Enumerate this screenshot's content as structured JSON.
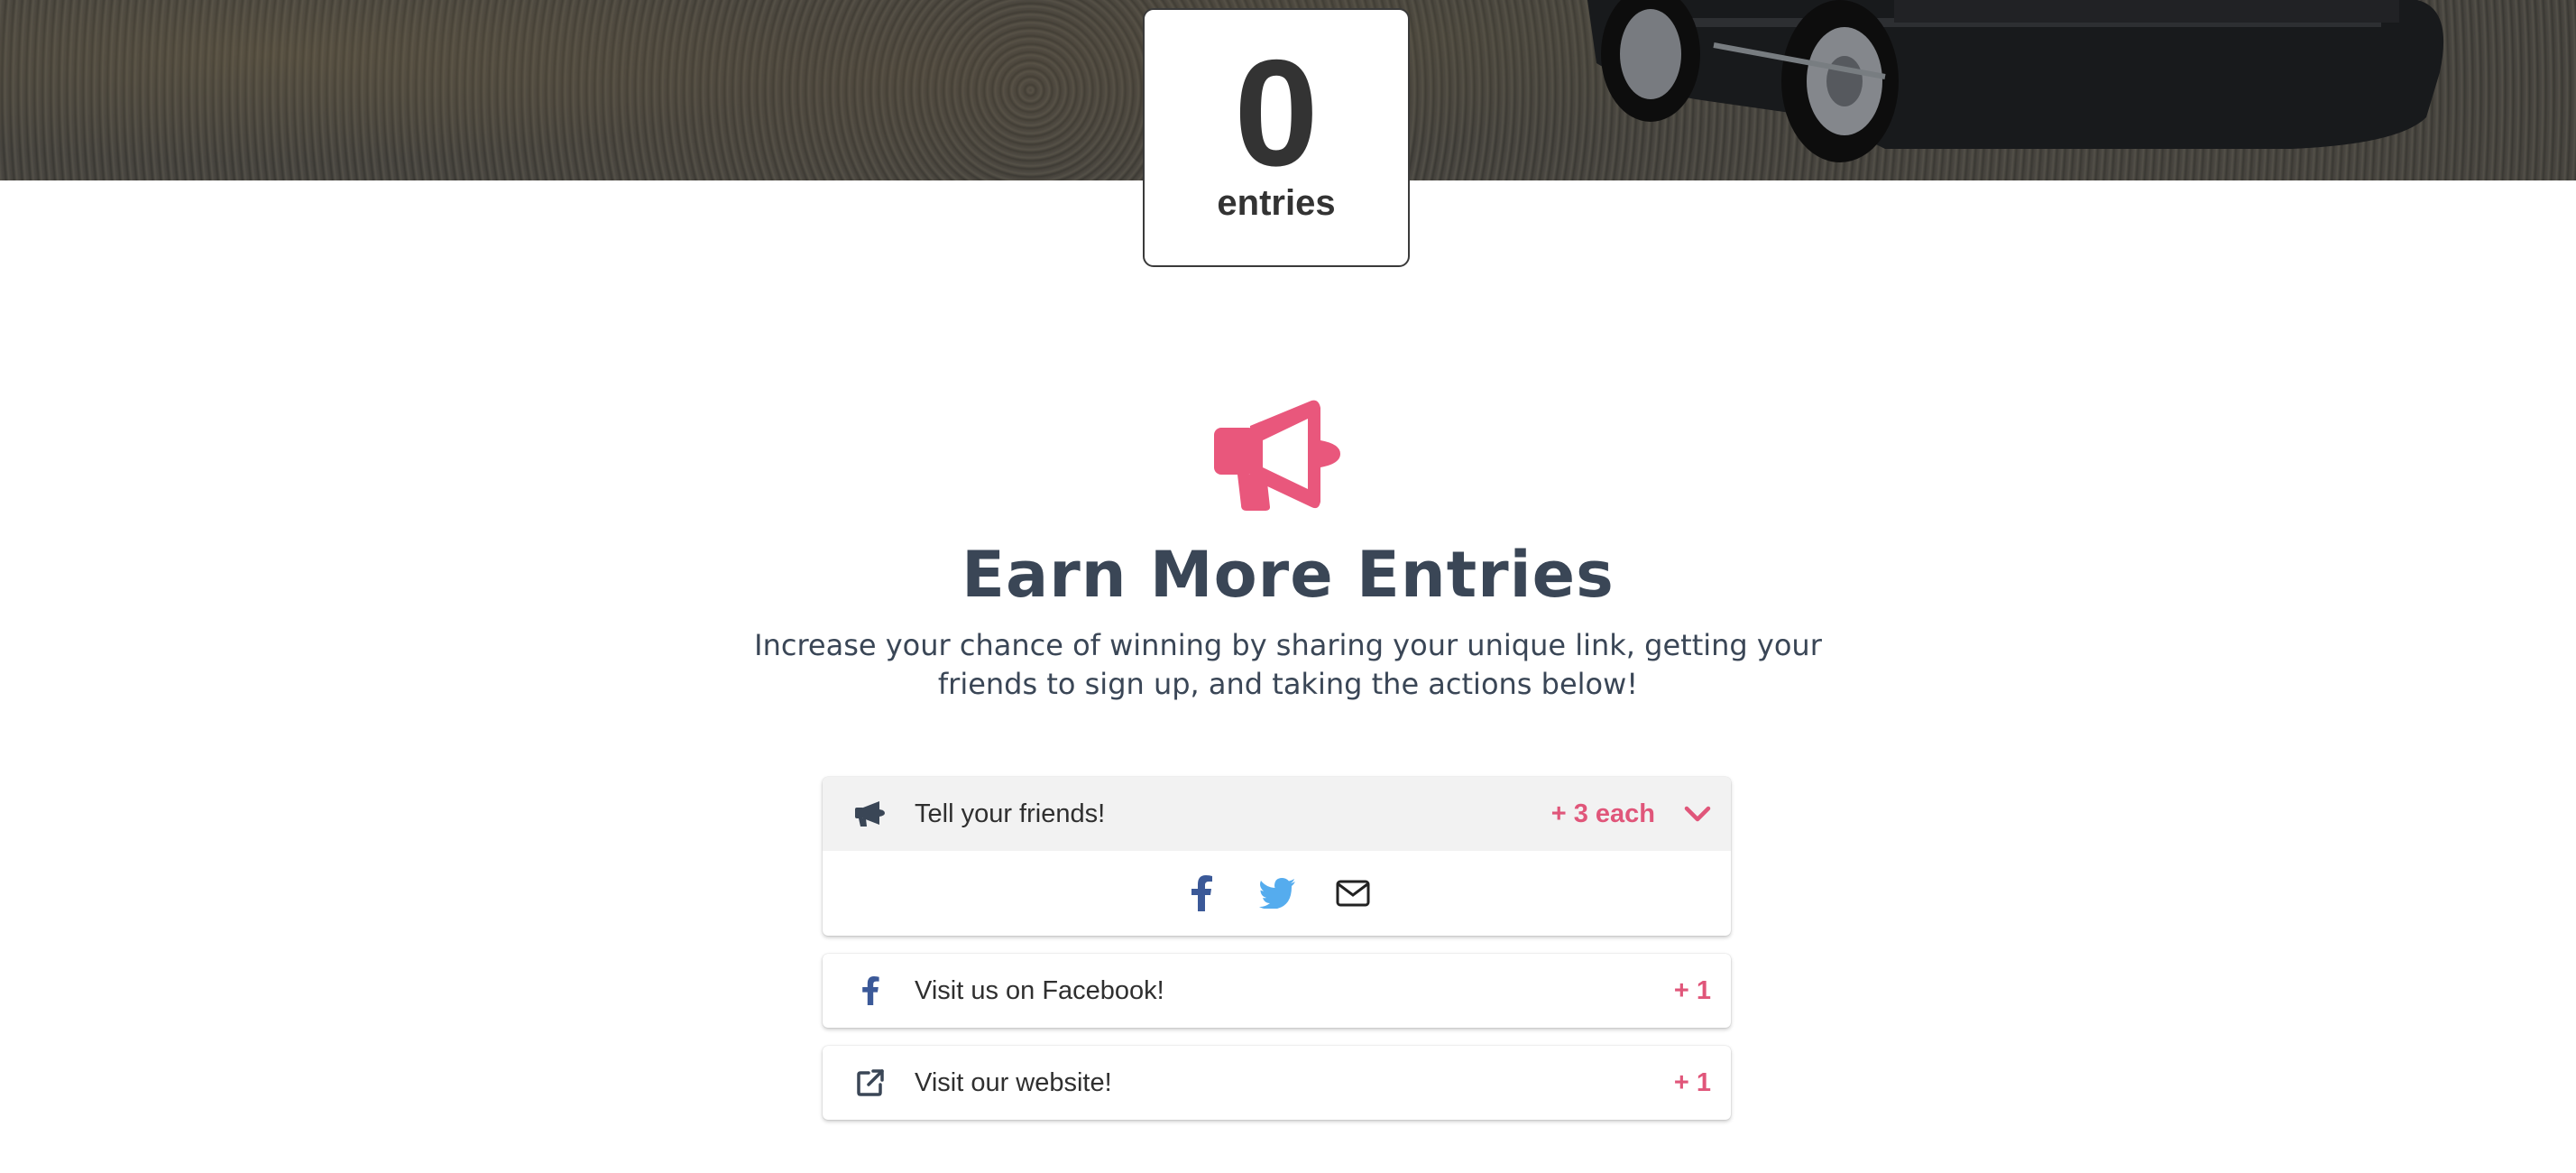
{
  "entries": {
    "count": "0",
    "label": "entries"
  },
  "earn": {
    "icon": "megaphone-icon",
    "title": "Earn More Entries",
    "subtitle": "Increase your chance of winning by sharing your unique link, getting your friends to sign up, and taking the actions below!"
  },
  "actions": [
    {
      "icon": "bullhorn-icon",
      "label": "Tell your friends!",
      "points": "+ 3 each",
      "expanded": true,
      "share_icons": [
        "facebook-icon",
        "twitter-icon",
        "email-icon"
      ]
    },
    {
      "icon": "facebook-icon",
      "label": "Visit us on Facebook!",
      "points": "+ 1"
    },
    {
      "icon": "external-link-icon",
      "label": "Visit our website!",
      "points": "+ 1"
    }
  ],
  "colors": {
    "accent": "#e0567a",
    "heading": "#3a4656",
    "facebook": "#3b5998",
    "twitter": "#55acee"
  }
}
